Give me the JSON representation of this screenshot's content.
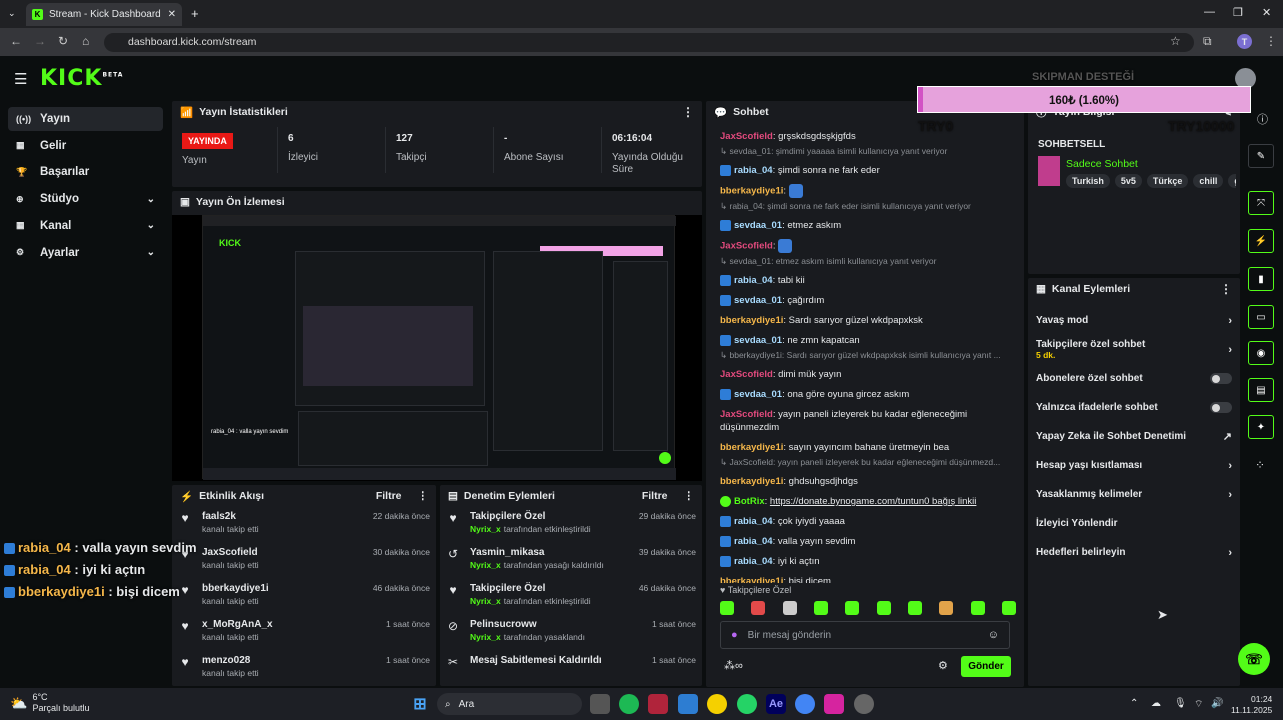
{
  "browser": {
    "tab_title": "Stream - Kick Dashboard",
    "url": "dashboard.kick.com/stream",
    "profile_initial": "T"
  },
  "logo": "KICK",
  "logo_sup": "BETA",
  "sidebar": [
    {
      "label": "Yayın"
    },
    {
      "label": "Gelir"
    },
    {
      "label": "Başarılar"
    },
    {
      "label": "Stüdyo"
    },
    {
      "label": "Kanal"
    },
    {
      "label": "Ayarlar"
    }
  ],
  "stats": {
    "title": "Yayın İstatistikleri",
    "live_badge": "YAYINDA",
    "live_label": "Yayın",
    "items": [
      {
        "value": "6",
        "label": "İzleyici"
      },
      {
        "value": "127",
        "label": "Takipçi"
      },
      {
        "value": "-",
        "label": "Abone Sayısı"
      },
      {
        "value": "06:16:04",
        "label": "Yayında Olduğu Süre"
      }
    ]
  },
  "preview": {
    "title": "Yayın Ön İzlemesi"
  },
  "events": {
    "title": "Etkinlik Akışı",
    "filter": "Filtre",
    "items": [
      {
        "name": "faals2k",
        "sub": "kanalı takip etti",
        "time": "22 dakika önce"
      },
      {
        "name": "JaxScofield",
        "sub": "kanalı takip etti",
        "time": "30 dakika önce"
      },
      {
        "name": "bberkaydiye1i",
        "sub": "kanalı takip etti",
        "time": "46 dakika önce"
      },
      {
        "name": "x_MoRgAnA_x",
        "sub": "kanalı takip etti",
        "time": "1 saat önce"
      },
      {
        "name": "menzo028",
        "sub": "kanalı takip etti",
        "time": "1 saat önce"
      }
    ]
  },
  "moderation": {
    "title": "Denetim Eylemleri",
    "filter": "Filtre",
    "items": [
      {
        "name": "Takipçilere Özel",
        "actor": "Nyrix_x",
        "sub": "tarafından etkinleştirildi",
        "time": "29 dakika önce"
      },
      {
        "name": "Yasmin_mikasa",
        "actor": "Nyrix_x",
        "sub": "tarafından yasağı kaldırıldı",
        "time": "39 dakika önce"
      },
      {
        "name": "Takipçilere Özel",
        "actor": "Nyrix_x",
        "sub": "tarafından etkinleştirildi",
        "time": "46 dakika önce"
      },
      {
        "name": "Pelinsucroww",
        "actor": "Nyrix_x",
        "sub": "tarafından yasaklandı",
        "time": "1 saat önce"
      },
      {
        "name": "Mesaj Sabitlemesi Kaldırıldı",
        "actor": "",
        "sub": "",
        "time": "1 saat önce"
      }
    ]
  },
  "chat": {
    "title": "Sohbet",
    "mode": "Takipçilere Özel",
    "placeholder": "Bir mesaj gönderin",
    "send": "Gönder",
    "lines": [
      {
        "type": "msg",
        "user": "JaxScofield",
        "color": "u-p",
        "text": "grşskdsgdsşkjgfds",
        "badge": false
      },
      {
        "type": "reply",
        "text": "sevdaa_01: şimdimi yaaaaa isimli kullanıcıya yanıt veriyor"
      },
      {
        "type": "msg",
        "user": "rabia_04",
        "color": "u-b",
        "text": "şimdi sonra ne fark eder",
        "badge": true
      },
      {
        "type": "msg",
        "user": "bberkaydiye1i",
        "color": "u-o",
        "text": "",
        "badge": false,
        "emote": true
      },
      {
        "type": "reply",
        "text": "rabia_04: şimdi sonra ne fark eder isimli kullanıcıya yanıt veriyor"
      },
      {
        "type": "msg",
        "user": "sevdaa_01",
        "color": "u-b",
        "text": "etmez askım",
        "badge": true
      },
      {
        "type": "msg",
        "user": "JaxScofield",
        "color": "u-p",
        "text": "",
        "badge": false,
        "emote": true
      },
      {
        "type": "reply",
        "text": "sevdaa_01: etmez askım isimli kullanıcıya yanıt veriyor"
      },
      {
        "type": "msg",
        "user": "rabia_04",
        "color": "u-b",
        "text": "tabi kii",
        "badge": true
      },
      {
        "type": "msg",
        "user": "sevdaa_01",
        "color": "u-b",
        "text": "çağırdım",
        "badge": true
      },
      {
        "type": "msg",
        "user": "bberkaydiye1i",
        "color": "u-o",
        "text": "Sardı sarıyor güzel wkdpapxksk",
        "badge": false
      },
      {
        "type": "msg",
        "user": "sevdaa_01",
        "color": "u-b",
        "text": "ne zmn kapatcan",
        "badge": true
      },
      {
        "type": "reply",
        "text": "bberkaydiye1i: Sardı sarıyor güzel wkdpapxksk isimli kullanıcıya yanıt ..."
      },
      {
        "type": "msg",
        "user": "JaxScofield",
        "color": "u-p",
        "text": "dimi mük yayın",
        "badge": false
      },
      {
        "type": "msg",
        "user": "sevdaa_01",
        "color": "u-b",
        "text": "ona göre oyuna gircez askım",
        "badge": true
      },
      {
        "type": "msg",
        "user": "JaxScofield",
        "color": "u-p",
        "text": "yayın paneli izleyerek bu kadar eğleneceğimi",
        "badge": false
      },
      {
        "type": "cont",
        "text": "düşünmezdim"
      },
      {
        "type": "msg",
        "user": "bberkaydiye1i",
        "color": "u-o",
        "text": "sayın yayıncım bahane üretmeyin bea",
        "badge": false
      },
      {
        "type": "reply",
        "text": "JaxScofield: yayın paneli izleyerek bu kadar eğleneceğimi düşünmezd..."
      },
      {
        "type": "msg",
        "user": "bberkaydiye1i",
        "color": "u-o",
        "text": "ghdsuhgsdjhdgs",
        "badge": false
      },
      {
        "type": "msg",
        "user": "BotRix",
        "color": "u-g",
        "text": "https://donate.bynogame.com/tuntun0 bağış linkii",
        "badge": true
      },
      {
        "type": "msg",
        "user": "rabia_04",
        "color": "u-b",
        "text": "çok iyiydi yaaaa",
        "badge": true
      },
      {
        "type": "msg",
        "user": "rabia_04",
        "color": "u-b",
        "text": "valla yayın sevdim",
        "badge": true
      },
      {
        "type": "msg",
        "user": "rabia_04",
        "color": "u-b",
        "text": "iyi ki açtın",
        "badge": true
      },
      {
        "type": "msg",
        "user": "bberkaydiye1i",
        "color": "u-o",
        "text": "bişi dicem",
        "badge": false
      }
    ]
  },
  "stream_info": {
    "title": "Yayın Bilgisi",
    "category": "SOHBETSELL",
    "mode": "Sadece Sohbet",
    "tags": [
      "Turkish",
      "5v5",
      "Türkçe",
      "chill",
      "g"
    ]
  },
  "donation": {
    "overlay_title": "SKIPMAN DESTEĞİ",
    "amount": "160₺ (1.60%)",
    "min": "TRY0",
    "max": "TRY10000",
    "progress": 0.016
  },
  "channel_actions": {
    "title": "Kanal Eylemleri",
    "items": [
      {
        "label": "Yavaş mod",
        "kind": "arrow",
        "sub": ""
      },
      {
        "label": "Takipçilere özel sohbet",
        "kind": "arrow",
        "sub": "5 dk."
      },
      {
        "label": "Abonelere özel sohbet",
        "kind": "toggle",
        "sub": ""
      },
      {
        "label": "Yalnızca ifadelerle sohbet",
        "kind": "toggle",
        "sub": ""
      },
      {
        "label": "Yapay Zeka ile Sohbet Denetimi",
        "kind": "ext",
        "sub": ""
      },
      {
        "label": "Hesap yaşı kısıtlaması",
        "kind": "arrow",
        "sub": ""
      },
      {
        "label": "Yasaklanmış kelimeler",
        "kind": "arrow",
        "sub": ""
      },
      {
        "label": "İzleyici Yönlendir",
        "kind": "none",
        "sub": ""
      },
      {
        "label": "Hedefleri belirleyin",
        "kind": "arrow",
        "sub": ""
      }
    ]
  },
  "overlay_chat": [
    {
      "user": "rabia_04",
      "text": "valla yayın sevdim"
    },
    {
      "user": "rabia_04",
      "text": "iyi ki açtın"
    },
    {
      "user": "bberkaydiye1i",
      "text": "bişi dicem"
    }
  ],
  "taskbar": {
    "temp": "6°C",
    "weather": "Parçalı bulutlu",
    "search": "Ara",
    "time": "01:24",
    "date": "11.11.2025"
  }
}
